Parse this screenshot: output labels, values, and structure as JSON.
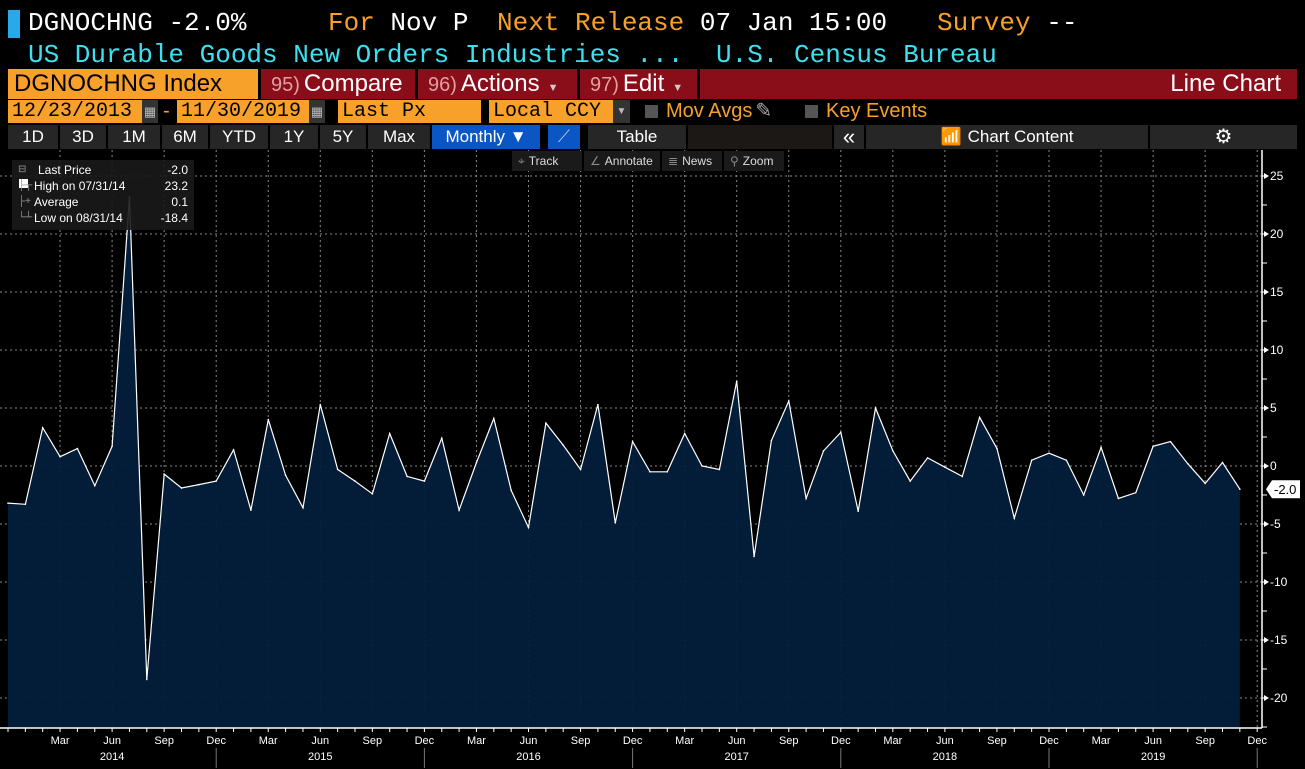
{
  "header": {
    "ticker": "DGNOCHNG",
    "last_change": "-2.0%",
    "for_label": "For",
    "for_value": "Nov P",
    "next_release_label": "Next Release",
    "next_release_value": "07 Jan 15:00",
    "survey_label": "Survey",
    "survey_value": "--",
    "description": "US Durable Goods New Orders Industries ...",
    "source": "U.S. Census Bureau"
  },
  "toolbar": {
    "security": "DGNOCHNG Index",
    "compare_num": "95)",
    "compare": "Compare",
    "actions_num": "96)",
    "actions": "Actions",
    "edit_num": "97)",
    "edit": "Edit",
    "chart_type": "Line Chart",
    "start_date": "12/23/2013",
    "date_sep": "-",
    "end_date": "11/30/2019",
    "field": "Last Px",
    "currency": "Local CCY",
    "mov_avgs": "Mov Avgs",
    "key_events": "Key Events",
    "periods": [
      "1D",
      "3D",
      "1M",
      "6M",
      "YTD",
      "1Y",
      "5Y",
      "Max"
    ],
    "frequency": "Monthly ▼",
    "table": "Table",
    "collapse": "«",
    "chart_content": "Chart Content",
    "chart_tools": [
      "Track",
      "Annotate",
      "News",
      "Zoom"
    ]
  },
  "legend": [
    {
      "label": "Last Price",
      "value": "-2.0"
    },
    {
      "label": "High on 07/31/14",
      "value": "23.2"
    },
    {
      "label": "Average",
      "value": "0.1"
    },
    {
      "label": "Low on 08/31/14",
      "value": "-18.4"
    }
  ],
  "colors": {
    "line": "#ffffff",
    "fill": "#031d3b",
    "accent": "#f7a02a",
    "header_red": "#8a0d1a",
    "cyan": "#3ee0f0"
  },
  "chart_data": {
    "type": "area",
    "title": "DGNOCHNG Index",
    "start": "2013-12",
    "frequency": "monthly",
    "values": [
      -3.2,
      -3.3,
      3.3,
      0.8,
      1.5,
      -1.7,
      1.7,
      23.2,
      -18.4,
      -0.7,
      -1.9,
      -1.6,
      -1.3,
      1.4,
      -3.8,
      4.0,
      -0.8,
      -3.6,
      5.3,
      -0.3,
      -1.3,
      -2.4,
      2.8,
      -0.9,
      -1.3,
      2.4,
      -3.8,
      0.3,
      4.1,
      -2.1,
      -5.3,
      3.7,
      1.8,
      -0.3,
      5.3,
      -4.9,
      2.1,
      -0.5,
      -0.5,
      2.8,
      0.0,
      -0.3,
      7.3,
      -7.8,
      2.2,
      5.6,
      -2.8,
      1.3,
      2.9,
      -3.9,
      5.0,
      1.3,
      -1.3,
      0.7,
      -0.1,
      -0.9,
      4.2,
      1.5,
      -4.5,
      0.5,
      1.1,
      0.5,
      -2.5,
      1.6,
      -2.8,
      -2.3,
      1.7,
      2.1,
      0.2,
      -1.5,
      0.3,
      -2.0
    ],
    "ylim": [
      -22,
      27
    ],
    "yticks": [
      25,
      20,
      15,
      10,
      5,
      0,
      -5,
      -10,
      -15,
      -20
    ],
    "ytick_labels": [
      "25",
      "20",
      "15",
      "10",
      "5",
      "0",
      "-5",
      "-10",
      "-15",
      "-20"
    ],
    "xtick_months": [
      "Mar",
      "Jun",
      "Sep",
      "Dec",
      "Mar",
      "Jun",
      "Sep",
      "Dec",
      "Mar",
      "Jun",
      "Sep",
      "Dec",
      "Mar",
      "Jun",
      "Sep",
      "Dec",
      "Mar",
      "Jun",
      "Sep",
      "Dec",
      "Mar",
      "Jun",
      "Sep",
      "Dec"
    ],
    "xtick_years": [
      "2014",
      "2015",
      "2016",
      "2017",
      "2018",
      "2019"
    ],
    "last_value_label": "-2.0",
    "grid": true
  }
}
